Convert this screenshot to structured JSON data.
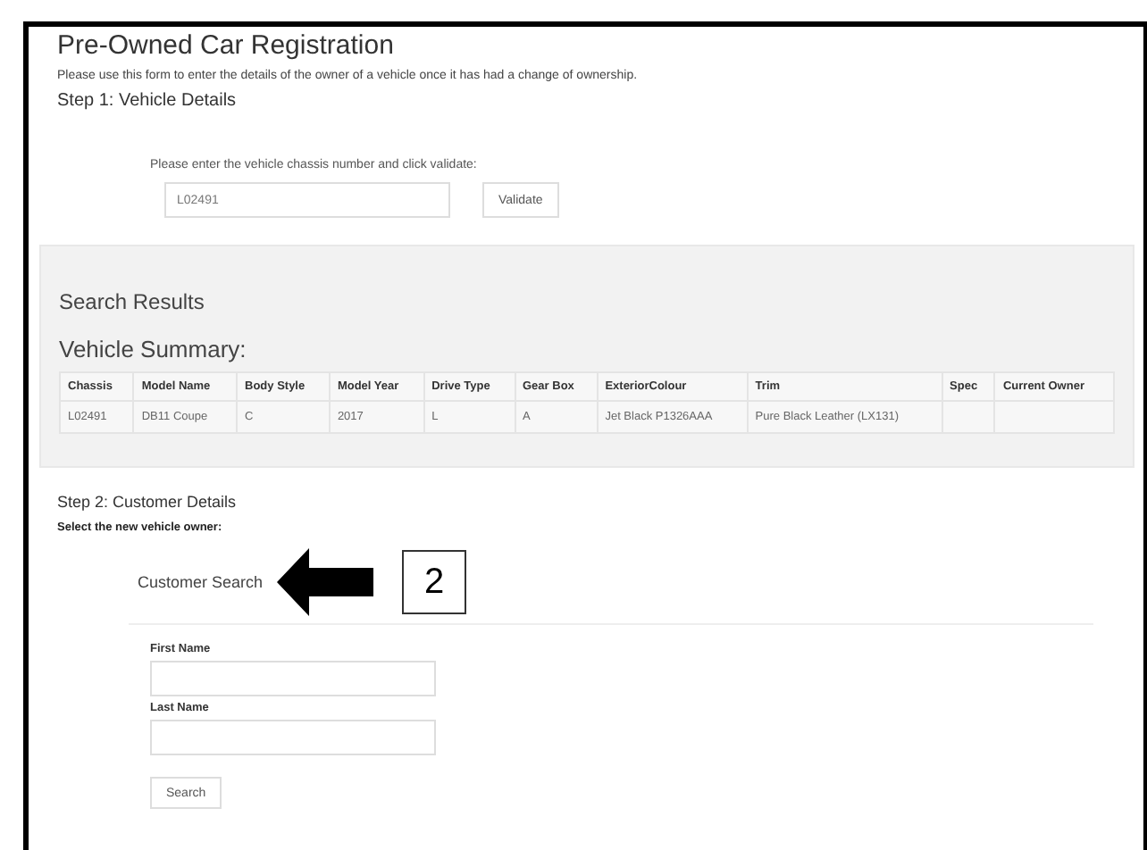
{
  "page": {
    "title": "Pre-Owned Car Registration",
    "description": "Please use this form to enter the details of the owner of a vehicle once it has had a change of ownership."
  },
  "step1": {
    "heading": "Step 1: Vehicle Details",
    "prompt": "Please enter the vehicle chassis number and click validate:",
    "chassis_field": {
      "value": "L02491"
    },
    "validate_button": "Validate"
  },
  "results": {
    "heading": "Search Results",
    "subheading": "Vehicle Summary:",
    "table": {
      "columns": [
        "Chassis",
        "Model Name",
        "Body Style",
        "Model Year",
        "Drive Type",
        "Gear Box",
        "ExteriorColour",
        "Trim",
        "Spec",
        "Current Owner"
      ],
      "rows": [
        [
          "L02491",
          "DB11 Coupe",
          "C",
          "2017",
          "L",
          "A",
          "Jet Black P1326AAA",
          "Pure Black Leather (LX131)",
          "",
          ""
        ]
      ]
    }
  },
  "step2": {
    "heading": "Step 2: Customer Details",
    "prompt": "Select the new vehicle owner:",
    "section": "Customer Search",
    "callout": "2",
    "fields": [
      {
        "label": "First Name"
      },
      {
        "label": "Last Name"
      }
    ],
    "search_button": "Search"
  }
}
